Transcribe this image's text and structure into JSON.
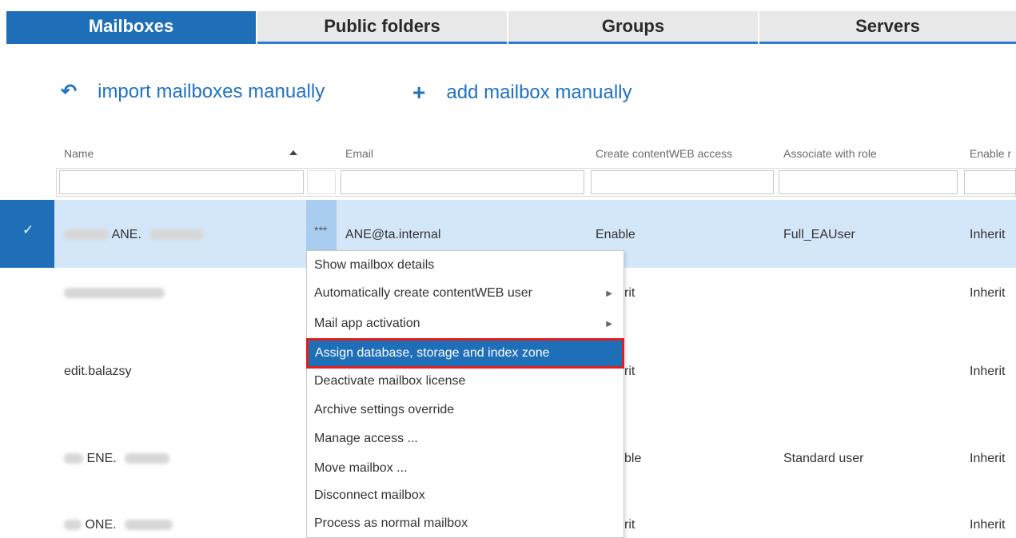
{
  "tabs": [
    {
      "label": "Mailboxes",
      "active": true
    },
    {
      "label": "Public folders",
      "active": false
    },
    {
      "label": "Groups",
      "active": false
    },
    {
      "label": "Servers",
      "active": false
    }
  ],
  "actions": {
    "import": {
      "icon": "undo-arrow-icon",
      "label": "import mailboxes manually"
    },
    "add": {
      "icon": "plus-icon",
      "label": "add mailbox manually"
    }
  },
  "columns": {
    "name": "Name",
    "email": "Email",
    "content_web": "Create contentWEB access",
    "role": "Associate with role",
    "enable": "Enable r"
  },
  "rows": [
    {
      "name": "ANE.",
      "ellipsis": "***",
      "email": "ANE@ta.internal",
      "content_web": "Enable",
      "role": "Full_EAUser",
      "enable": "Inherit",
      "selected": true
    },
    {
      "name": "",
      "content_web": "rit",
      "role": "",
      "enable": "Inherit"
    },
    {
      "name": "edit.balazsy",
      "content_web": "rit",
      "role": "",
      "enable": "Inherit"
    },
    {
      "name": "ENE.",
      "content_web": "ble",
      "role": "Standard user",
      "enable": "Inherit"
    },
    {
      "name": "ONE.",
      "content_web": "rit",
      "role": "",
      "enable": "Inherit"
    }
  ],
  "context_menu": {
    "items": [
      {
        "label": "Show mailbox details",
        "submenu": false
      },
      {
        "label": "Automatically create contentWEB user",
        "submenu": true
      },
      {
        "label": "Mail app activation",
        "submenu": true
      },
      {
        "label": "Assign database, storage and index zone",
        "submenu": false,
        "highlighted": true
      },
      {
        "label": "Deactivate mailbox license",
        "submenu": false
      },
      {
        "label": "Archive settings override",
        "submenu": false
      },
      {
        "label": "Manage access ...",
        "submenu": false
      },
      {
        "label": "Move mailbox ...",
        "submenu": false
      },
      {
        "label": "Disconnect mailbox",
        "submenu": false
      },
      {
        "label": "Process as normal mailbox",
        "submenu": false
      }
    ]
  },
  "colors": {
    "accent": "#1e6fb8",
    "selected_row": "#d3e7f9",
    "highlight_border": "#e21d1d",
    "link": "#1f72c4"
  }
}
